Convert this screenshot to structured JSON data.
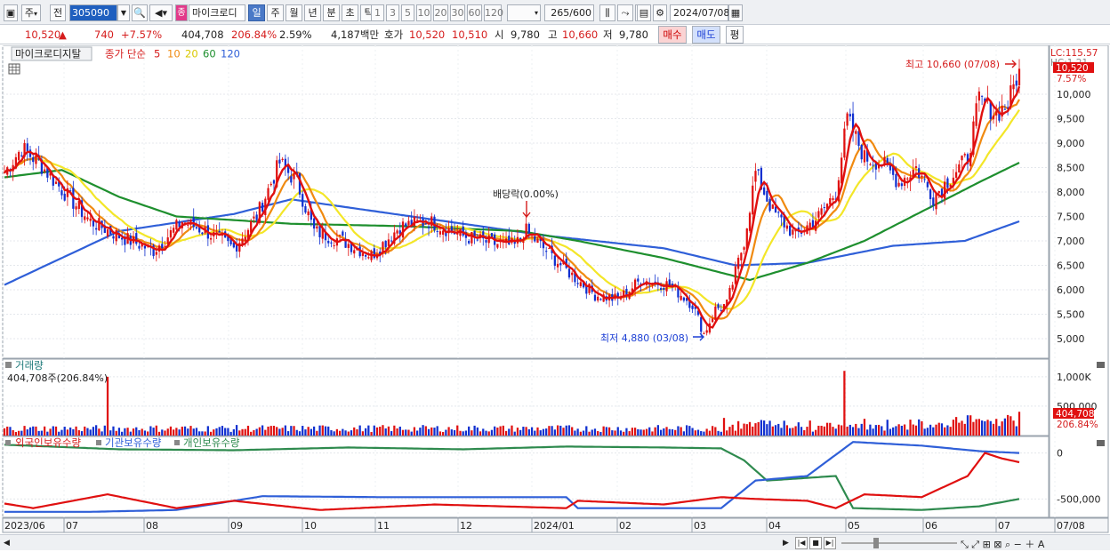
{
  "toolbar": {
    "period_select": "주",
    "prev_label": "전",
    "stock_code": "305090",
    "stock_name_badge": "종",
    "stock_name": "마이크로디",
    "period_tabs": [
      "일",
      "주",
      "월",
      "년",
      "분",
      "초",
      "틱"
    ],
    "interval_buttons": [
      "1",
      "3",
      "5",
      "10",
      "20",
      "30",
      "60",
      "120"
    ],
    "count_value": "265",
    "count_total": "/600",
    "date_value": "2024/07/08"
  },
  "info": {
    "price": "10,520",
    "change_arrow": "▲",
    "change": "740",
    "change_pct": "+7.57%",
    "volume": "404,708",
    "volume_ratio": "206.84%",
    "turnover": "2.59%",
    "amount": "4,187백만",
    "quote_label": "호가",
    "ask": "10,520",
    "bid": "10,510",
    "open_label": "시",
    "open": "9,780",
    "high_label": "고",
    "high": "10,660",
    "low_label": "저",
    "low": "9,780",
    "buy_button": "매수",
    "sell_button": "매도",
    "eval_button": "평"
  },
  "legend": {
    "stock_name": "마이크로디지탈",
    "ma_label": "종가 단순",
    "ma_periods": [
      "5",
      "10",
      "20",
      "60",
      "120"
    ],
    "volume_title": "거래량",
    "volume_value": "404,708주(206.84%)",
    "holdings_foreign": "외국인보유수량",
    "holdings_inst": "기관보유수량",
    "holdings_indiv": "개인보유수량"
  },
  "annotations": {
    "high_label": "최고 10,660 (07/08)",
    "low_label": "최저 4,880 (03/08)",
    "dividend_label": "배당락(0.00%)",
    "lc_label": "LC:115.57",
    "hc_label": "HC:1.21",
    "current_price_tag": "10,520",
    "current_pct_tag": "7.57%",
    "volume_tag": "404,708",
    "volume_pct_tag": "206.84%"
  },
  "colors": {
    "up": "#e01010",
    "down": "#1030d0",
    "ma5": "#e01010",
    "ma10": "#f08a10",
    "ma20": "#f3e628",
    "ma60": "#1e8f2e",
    "ma120": "#2f5fd8",
    "foreign": "#e01010",
    "institution": "#2f5fd8",
    "individual": "#2e8a4e"
  },
  "chart_data": {
    "type": "line",
    "title": "마이크로디지탈",
    "price_axis": {
      "ticks": [
        5000,
        5500,
        6000,
        6500,
        7000,
        7500,
        8000,
        8500,
        9000,
        9500,
        10000
      ],
      "range": [
        4600,
        11000
      ]
    },
    "volume_axis": {
      "ticks": [
        "1,000K",
        "500,000"
      ],
      "range": [
        0,
        1300000
      ]
    },
    "holdings_axis": {
      "ticks": [
        "0",
        "-500,000"
      ],
      "range": [
        -700000,
        180000
      ]
    },
    "x_labels": [
      "2023/06",
      "07",
      "08",
      "09",
      "10",
      "11",
      "12",
      "2024/01",
      "02",
      "03",
      "04",
      "05",
      "06",
      "07",
      "07/08"
    ],
    "price_anchors": [
      [
        0,
        8400
      ],
      [
        6,
        8900
      ],
      [
        12,
        8600
      ],
      [
        20,
        8050
      ],
      [
        30,
        7400
      ],
      [
        40,
        7100
      ],
      [
        52,
        6800
      ],
      [
        62,
        7400
      ],
      [
        70,
        7200
      ],
      [
        80,
        6850
      ],
      [
        88,
        7500
      ],
      [
        96,
        8600
      ],
      [
        102,
        8200
      ],
      [
        108,
        7200
      ],
      [
        118,
        7000
      ],
      [
        128,
        6700
      ],
      [
        138,
        7300
      ],
      [
        148,
        7400
      ],
      [
        160,
        7100
      ],
      [
        170,
        6950
      ],
      [
        178,
        6900
      ],
      [
        182,
        7200
      ],
      [
        188,
        6850
      ],
      [
        196,
        6400
      ],
      [
        206,
        5900
      ],
      [
        214,
        5800
      ],
      [
        222,
        6200
      ],
      [
        232,
        6100
      ],
      [
        240,
        5700
      ],
      [
        244,
        5100
      ],
      [
        248,
        5600
      ],
      [
        252,
        5700
      ],
      [
        258,
        7000
      ],
      [
        262,
        8400
      ],
      [
        268,
        7600
      ],
      [
        276,
        7100
      ],
      [
        284,
        7500
      ],
      [
        290,
        8000
      ],
      [
        294,
        9500
      ],
      [
        300,
        8700
      ],
      [
        306,
        8600
      ],
      [
        312,
        8200
      ],
      [
        318,
        8500
      ],
      [
        324,
        7900
      ],
      [
        330,
        8300
      ],
      [
        336,
        8700
      ],
      [
        340,
        9900
      ],
      [
        346,
        9600
      ],
      [
        350,
        9800
      ],
      [
        354,
        10520
      ]
    ],
    "ma60_anchors": [
      [
        0,
        8300
      ],
      [
        20,
        8450
      ],
      [
        40,
        7900
      ],
      [
        60,
        7500
      ],
      [
        100,
        7350
      ],
      [
        140,
        7300
      ],
      [
        180,
        7200
      ],
      [
        200,
        7000
      ],
      [
        230,
        6650
      ],
      [
        260,
        6200
      ],
      [
        280,
        6550
      ],
      [
        300,
        7000
      ],
      [
        320,
        7600
      ],
      [
        340,
        8200
      ],
      [
        354,
        8600
      ]
    ],
    "ma120_anchors": [
      [
        0,
        6100
      ],
      [
        40,
        7200
      ],
      [
        80,
        7550
      ],
      [
        100,
        7850
      ],
      [
        130,
        7600
      ],
      [
        160,
        7350
      ],
      [
        190,
        7100
      ],
      [
        230,
        6850
      ],
      [
        255,
        6500
      ],
      [
        280,
        6550
      ],
      [
        310,
        6900
      ],
      [
        335,
        7000
      ],
      [
        354,
        7400
      ]
    ],
    "volume_spikes": [
      [
        36,
        1000000
      ],
      [
        293,
        1100000
      ],
      [
        251,
        300000
      ],
      [
        260,
        230000
      ]
    ],
    "holdings": {
      "foreign_anchors": [
        [
          0,
          -550000
        ],
        [
          10,
          -600000
        ],
        [
          36,
          -450000
        ],
        [
          60,
          -600000
        ],
        [
          80,
          -520000
        ],
        [
          110,
          -620000
        ],
        [
          150,
          -560000
        ],
        [
          196,
          -600000
        ],
        [
          200,
          -520000
        ],
        [
          230,
          -560000
        ],
        [
          250,
          -480000
        ],
        [
          262,
          -500000
        ],
        [
          280,
          -520000
        ],
        [
          290,
          -600000
        ],
        [
          300,
          -450000
        ],
        [
          320,
          -480000
        ],
        [
          336,
          -250000
        ],
        [
          342,
          0
        ],
        [
          348,
          -60000
        ],
        [
          354,
          -100000
        ]
      ],
      "institution_anchors": [
        [
          0,
          -640000
        ],
        [
          30,
          -640000
        ],
        [
          60,
          -620000
        ],
        [
          90,
          -470000
        ],
        [
          130,
          -480000
        ],
        [
          196,
          -480000
        ],
        [
          200,
          -600000
        ],
        [
          250,
          -600000
        ],
        [
          262,
          -300000
        ],
        [
          280,
          -250000
        ],
        [
          296,
          120000
        ],
        [
          320,
          80000
        ],
        [
          340,
          20000
        ],
        [
          354,
          0
        ]
      ],
      "individual_anchors": [
        [
          0,
          90000
        ],
        [
          40,
          40000
        ],
        [
          80,
          30000
        ],
        [
          120,
          60000
        ],
        [
          160,
          40000
        ],
        [
          196,
          70000
        ],
        [
          230,
          60000
        ],
        [
          250,
          50000
        ],
        [
          258,
          -80000
        ],
        [
          266,
          -300000
        ],
        [
          290,
          -250000
        ],
        [
          296,
          -600000
        ],
        [
          320,
          -620000
        ],
        [
          340,
          -580000
        ],
        [
          354,
          -500000
        ]
      ]
    }
  }
}
